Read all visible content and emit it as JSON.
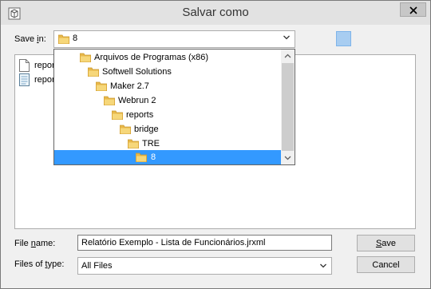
{
  "window": {
    "title": "Salvar como"
  },
  "save_in": {
    "label": "Save in:",
    "label_prefix": "Save ",
    "label_underlined": "i",
    "label_suffix": "n:",
    "value": "8"
  },
  "file_list": {
    "items": [
      {
        "name": "repor",
        "type": "document"
      },
      {
        "name": "repor",
        "type": "report"
      }
    ]
  },
  "dropdown": {
    "items": [
      {
        "label": "Arquivos de Programas (x86)",
        "depth": 0,
        "selected": false
      },
      {
        "label": "Softwell Solutions",
        "depth": 1,
        "selected": false
      },
      {
        "label": "Maker 2.7",
        "depth": 2,
        "selected": false
      },
      {
        "label": "Webrun 2",
        "depth": 3,
        "selected": false
      },
      {
        "label": "reports",
        "depth": 4,
        "selected": false
      },
      {
        "label": "bridge",
        "depth": 5,
        "selected": false
      },
      {
        "label": "TRE",
        "depth": 6,
        "selected": false
      },
      {
        "label": "8",
        "depth": 7,
        "selected": true
      }
    ]
  },
  "file_name": {
    "label": "File name:",
    "label_prefix": "File ",
    "label_underlined": "n",
    "label_suffix": "ame:",
    "value": "Relatório Exemplo - Lista de Funcionários.jrxml"
  },
  "file_type": {
    "label": "Files of type:",
    "label_prefix": "Files of ",
    "label_underlined": "t",
    "label_suffix": "ype:",
    "value": "All Files"
  },
  "buttons": {
    "save": "Save",
    "save_underlined": "S",
    "save_rest": "ave",
    "cancel": "Cancel"
  },
  "colors": {
    "selection": "#3399ff",
    "folder": "#e8b84a",
    "titlebar": "#e2e2e2"
  }
}
